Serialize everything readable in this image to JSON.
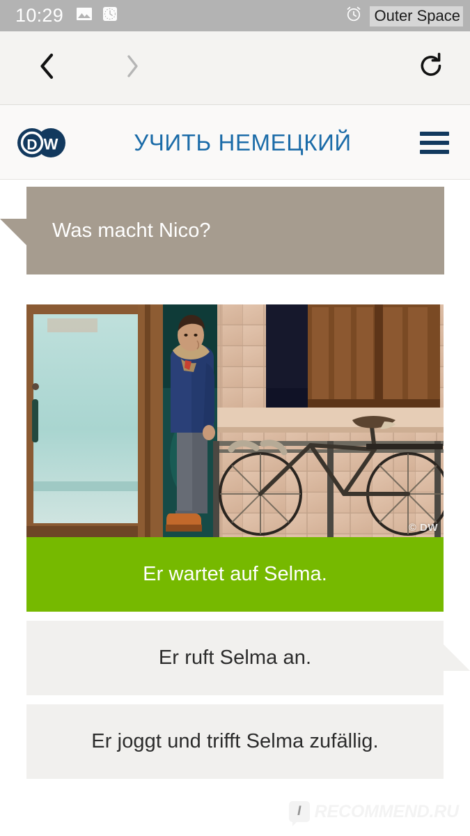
{
  "status_bar": {
    "clock": "10:29",
    "left_icons": [
      "image-icon",
      "clock-icon"
    ],
    "right_icons": [
      "alarm-icon",
      "vibrate-icon",
      "download-arrow-icon",
      "signal-off-icon",
      "battery-icon"
    ],
    "overlay_label": "Outer Space"
  },
  "browser": {
    "back_label": "‹",
    "forward_label": "›",
    "reload_label": "↻",
    "icons": [
      "back-chevron-icon",
      "forward-chevron-icon",
      "reload-icon"
    ]
  },
  "site_header": {
    "logo_alt": "DW",
    "logo_letters": {
      "first": "D",
      "second": "W"
    },
    "title": "УЧИТЬ НЕМЕЦКИЙ",
    "menu_icon": "hamburger-menu-icon",
    "title_color": "#1A6BA8",
    "logo_color": "#12395E"
  },
  "exercise": {
    "question": "Was macht Nico?",
    "question_bg": "#A69C8F",
    "photo": {
      "credit": "© DW",
      "description": "Man in blue jacket standing in doorway next to brick wall with bicycle"
    },
    "options": [
      {
        "text": "Er wartet auf Selma.",
        "state": "correct",
        "bg": "#76B900"
      },
      {
        "text": "Er ruft Selma an.",
        "state": "default",
        "bg": "#F1F0EE"
      },
      {
        "text": "Er joggt und trifft Selma zufällig.",
        "state": "default",
        "bg": "#F1F0EE"
      }
    ]
  },
  "watermark": {
    "badge": "I",
    "text": "RECOMMEND.RU"
  }
}
